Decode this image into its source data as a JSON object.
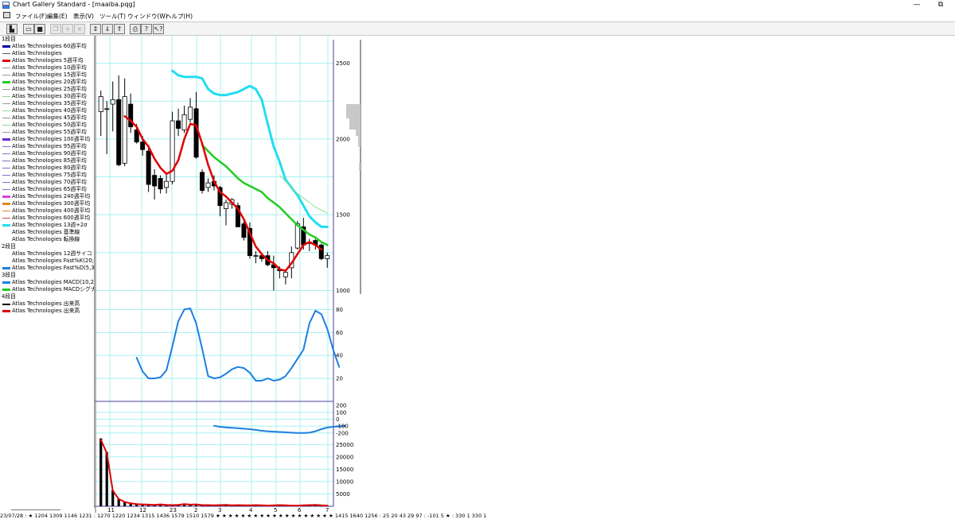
{
  "window": {
    "title": "Chart Gallery Standard - [maaiba.pqg]",
    "minimize_glyph": "—",
    "restore_glyph": "⧉"
  },
  "menu": [
    "ファイル(F)",
    "編集(E)",
    "表示(V)",
    "ツール(T)",
    "ウィンドウ(W)",
    "ヘルプ(H)"
  ],
  "toolbar": [
    {
      "name": "new-chart-icon",
      "glyph": "▙",
      "enabled": true
    },
    {
      "name": "open-folder-icon",
      "glyph": "▭",
      "enabled": true
    },
    {
      "name": "save-disk-icon",
      "glyph": "■",
      "enabled": true
    },
    {
      "name": "copy-icon",
      "glyph": "❐",
      "enabled": false
    },
    {
      "name": "add-icon",
      "glyph": "+",
      "enabled": false
    },
    {
      "name": "delete-icon",
      "glyph": "×",
      "enabled": false
    },
    {
      "name": "zoom-fit-icon",
      "glyph": "↕",
      "enabled": true
    },
    {
      "name": "scroll-down-icon",
      "glyph": "⇓",
      "enabled": true
    },
    {
      "name": "scroll-up-icon",
      "glyph": "⇑",
      "enabled": true
    },
    {
      "name": "print-icon",
      "glyph": "⎙",
      "enabled": true
    },
    {
      "name": "help-icon",
      "glyph": "?",
      "enabled": true
    },
    {
      "name": "context-help-icon",
      "glyph": "↖?",
      "enabled": true
    }
  ],
  "legend": [
    {
      "header": "1段目"
    },
    {
      "label": "Atlas  Technologies  60週平均",
      "color": "#0000a0",
      "weight": 3
    },
    {
      "label": "Atlas  Technologies",
      "color": "#5a5a5a",
      "weight": 1
    },
    {
      "label": "Atlas  Technologies  5週平均",
      "color": "#e00000",
      "weight": 3
    },
    {
      "label": "Atlas  Technologies  10週平均",
      "color": "#9a9a9a",
      "weight": 1
    },
    {
      "label": "Atlas  Technologies  15週平均",
      "color": "#9a9a9a",
      "weight": 1
    },
    {
      "label": "Atlas  Technologies  20週平均",
      "color": "#22cc22",
      "weight": 3
    },
    {
      "label": "Atlas  Technologies  25週平均",
      "color": "#9a9a9a",
      "weight": 1
    },
    {
      "label": "Atlas  Technologies  30週平均",
      "color": "#8fd88f",
      "weight": 1
    },
    {
      "label": "Atlas  Technologies  35週平均",
      "color": "#9a9a9a",
      "weight": 1
    },
    {
      "label": "Atlas  Technologies  40週平均",
      "color": "#8fd88f",
      "weight": 1
    },
    {
      "label": "Atlas  Technologies  45週平均",
      "color": "#9a9a9a",
      "weight": 1
    },
    {
      "label": "Atlas  Technologies  50週平均",
      "color": "#8fd88f",
      "weight": 1
    },
    {
      "label": "Atlas  Technologies  55週平均",
      "color": "#9a9a9a",
      "weight": 1
    },
    {
      "label": "Atlas  Technologies  100週平均",
      "color": "#6a2bd6",
      "weight": 3
    },
    {
      "label": "Atlas  Technologies  95週平均",
      "color": "#7878c8",
      "weight": 1
    },
    {
      "label": "Atlas  Technologies  90週平均",
      "color": "#7878c8",
      "weight": 1
    },
    {
      "label": "Atlas  Technologies  85週平均",
      "color": "#7878c8",
      "weight": 1
    },
    {
      "label": "Atlas  Technologies  80週平均",
      "color": "#7878c8",
      "weight": 1
    },
    {
      "label": "Atlas  Technologies  75週平均",
      "color": "#7878c8",
      "weight": 1
    },
    {
      "label": "Atlas  Technologies  70週平均",
      "color": "#7878c8",
      "weight": 1
    },
    {
      "label": "Atlas  Technologies  65週平均",
      "color": "#7878c8",
      "weight": 1
    },
    {
      "label": "Atlas  Technologies  240週平均",
      "color": "#e040e0",
      "weight": 3
    },
    {
      "label": "Atlas  Technologies  300週平均",
      "color": "#e08a20",
      "weight": 3
    },
    {
      "label": "Atlas  Technologies  400週平均",
      "color": "#e08a20",
      "weight": 1
    },
    {
      "label": "Atlas  Technologies  600週平均",
      "color": "#c05050",
      "weight": 1
    },
    {
      "label": "Atlas  Technologies  13週+2σ",
      "color": "#22ddf0",
      "weight": 3
    },
    {
      "label": "Atlas  Technologies  基準線",
      "color": "#ffffff",
      "weight": 1
    },
    {
      "label": "Atlas  Technologies  転換線",
      "color": "#ffffff",
      "weight": 1
    },
    {
      "header": "2段目"
    },
    {
      "label": "Atlas  Technologies  12週サイコ",
      "color": "#ffffff",
      "weight": 1
    },
    {
      "label": "Atlas  Technologies  Fast%K(20;",
      "color": "#ffffff",
      "weight": 1
    },
    {
      "label": "Atlas  Technologies  Fast%D(5,3",
      "color": "#1e7fe0",
      "weight": 3
    },
    {
      "header": "3段目"
    },
    {
      "label": "Atlas  Technologies  MACD(10,2",
      "color": "#1e7fe0",
      "weight": 3
    },
    {
      "label": "Atlas  Technologies  MACDシグナ",
      "color": "#22cc22",
      "weight": 3
    },
    {
      "header": "4段目"
    },
    {
      "label": "Atlas  Technologies  出来高",
      "color": "#000000",
      "weight": 2
    },
    {
      "label": "Atlas  Technologies  出来高",
      "color": "#e00000",
      "weight": 3
    }
  ],
  "x_axis_labels": [
    "11",
    "12",
    "23",
    "2",
    "3",
    "4",
    "5",
    "6",
    "7"
  ],
  "price_axis": {
    "ticks": [
      "2500",
      "2000",
      "1500",
      "1000"
    ],
    "values": [
      2500,
      2000,
      1500,
      1000
    ],
    "min": 950,
    "max": 2650
  },
  "osc_axis": {
    "ticks": [
      "80",
      "60",
      "40",
      "20"
    ],
    "values": [
      80,
      60,
      40,
      20
    ],
    "min": 0,
    "max": 90
  },
  "macd_axis": {
    "ticks": [
      "200",
      "100",
      "0",
      "-100",
      "-200"
    ],
    "values": [
      200,
      100,
      0,
      -100,
      -200
    ],
    "min": -260,
    "max": 260
  },
  "volume_axis": {
    "ticks": [
      "25000",
      "20000",
      "15000",
      "10000",
      "5000"
    ],
    "values": [
      25000,
      20000,
      15000,
      10000,
      5000
    ],
    "min": 0,
    "max": 28000
  },
  "colors": {
    "grid": "#a8f0f0",
    "candle_down": "#000000",
    "ma5": "#e00000",
    "ma20": "#22cc22",
    "ma30": "#90e090",
    "band": "#22ddf0",
    "oscillator": "#1e7fe0",
    "macd": "#1e7fe0",
    "volume_line": "#e00000",
    "axis": "#4b3c9c"
  },
  "candles": [
    {
      "o": 2180,
      "h": 2320,
      "l": 2020,
      "c": 2280
    },
    {
      "o": 2200,
      "h": 2250,
      "l": 1900,
      "c": 2200
    },
    {
      "o": 2230,
      "h": 2380,
      "l": 2050,
      "c": 2260
    },
    {
      "o": 2260,
      "h": 2420,
      "l": 1820,
      "c": 1830
    },
    {
      "o": 1840,
      "h": 2400,
      "l": 1820,
      "c": 2280
    },
    {
      "o": 2230,
      "h": 2300,
      "l": 2040,
      "c": 2080
    },
    {
      "o": 2060,
      "h": 2100,
      "l": 1970,
      "c": 1980
    },
    {
      "o": 1980,
      "h": 2020,
      "l": 1890,
      "c": 1930
    },
    {
      "o": 1920,
      "h": 1960,
      "l": 1650,
      "c": 1700
    },
    {
      "o": 1760,
      "h": 1800,
      "l": 1600,
      "c": 1690
    },
    {
      "o": 1740,
      "h": 1760,
      "l": 1640,
      "c": 1670
    },
    {
      "o": 1680,
      "h": 1780,
      "l": 1640,
      "c": 1720
    },
    {
      "o": 1720,
      "h": 2180,
      "l": 1700,
      "c": 2120
    },
    {
      "o": 2120,
      "h": 2200,
      "l": 2020,
      "c": 2070
    },
    {
      "o": 2060,
      "h": 2220,
      "l": 2040,
      "c": 2160
    },
    {
      "o": 2130,
      "h": 2270,
      "l": 2110,
      "c": 2210
    },
    {
      "o": 2200,
      "h": 2310,
      "l": 1870,
      "c": 1880
    },
    {
      "o": 1780,
      "h": 1800,
      "l": 1640,
      "c": 1660
    },
    {
      "o": 1680,
      "h": 1740,
      "l": 1650,
      "c": 1710
    },
    {
      "o": 1720,
      "h": 1760,
      "l": 1660,
      "c": 1690
    },
    {
      "o": 1680,
      "h": 1690,
      "l": 1490,
      "c": 1560
    },
    {
      "o": 1540,
      "h": 1600,
      "l": 1430,
      "c": 1580
    },
    {
      "o": 1570,
      "h": 1610,
      "l": 1540,
      "c": 1600
    },
    {
      "o": 1560,
      "h": 1580,
      "l": 1420,
      "c": 1420
    },
    {
      "o": 1440,
      "h": 1470,
      "l": 1330,
      "c": 1350
    },
    {
      "o": 1410,
      "h": 1450,
      "l": 1210,
      "c": 1230
    },
    {
      "o": 1230,
      "h": 1260,
      "l": 1180,
      "c": 1230
    },
    {
      "o": 1230,
      "h": 1250,
      "l": 1190,
      "c": 1210
    },
    {
      "o": 1230,
      "h": 1260,
      "l": 1160,
      "c": 1170
    },
    {
      "o": 1170,
      "h": 1230,
      "l": 1000,
      "c": 1150
    },
    {
      "o": 1140,
      "h": 1160,
      "l": 1080,
      "c": 1130
    },
    {
      "o": 1090,
      "h": 1140,
      "l": 1040,
      "c": 1120
    },
    {
      "o": 1150,
      "h": 1290,
      "l": 1080,
      "c": 1250
    },
    {
      "o": 1280,
      "h": 1460,
      "l": 1270,
      "c": 1440
    },
    {
      "o": 1420,
      "h": 1480,
      "l": 1270,
      "c": 1300
    },
    {
      "o": 1310,
      "h": 1340,
      "l": 1260,
      "c": 1320
    },
    {
      "o": 1330,
      "h": 1340,
      "l": 1270,
      "c": 1300
    },
    {
      "o": 1300,
      "h": 1310,
      "l": 1200,
      "c": 1210
    },
    {
      "o": 1210,
      "h": 1250,
      "l": 1150,
      "c": 1230
    }
  ],
  "ma5": [
    2150,
    2120,
    2080,
    2000,
    1950,
    1870,
    1810,
    1770,
    1790,
    1860,
    2000,
    2100,
    2090,
    1970,
    1830,
    1720,
    1650,
    1620,
    1580,
    1540,
    1470,
    1380,
    1290,
    1240,
    1200,
    1180,
    1140,
    1130,
    1180,
    1240,
    1300,
    1320,
    1300,
    1270
  ],
  "ma5_start": 4,
  "ma20": [
    1960,
    1920,
    1880,
    1850,
    1820,
    1780,
    1740,
    1710,
    1690,
    1670,
    1650,
    1610,
    1580,
    1550,
    1510,
    1470,
    1430,
    1400,
    1370,
    1350,
    1320,
    1300
  ],
  "ma20_start": 17,
  "ma30": [
    1760,
    1720,
    1680,
    1640,
    1610,
    1580,
    1550,
    1530,
    1510
  ],
  "ma30_start": 30,
  "band_upper": [
    2450,
    2420,
    2410,
    2410,
    2410,
    2400,
    2330,
    2300,
    2290,
    2290,
    2300,
    2310,
    2330,
    2350,
    2330,
    2260,
    2100,
    1950,
    1850,
    1730,
    1680,
    1630,
    1560,
    1490,
    1450,
    1420,
    1420
  ],
  "band_start": 12,
  "oscillator": [
    38,
    26,
    20,
    20,
    21,
    27,
    48,
    70,
    80,
    81,
    68,
    46,
    22,
    20,
    21,
    24,
    28,
    30,
    29,
    25,
    18,
    18,
    20,
    18,
    19,
    22,
    29,
    37,
    45,
    68,
    79,
    76,
    63,
    45,
    30
  ],
  "oscillator_start": 6,
  "macd": [
    -95,
    -110,
    -118,
    -125,
    -130,
    -138,
    -145,
    -155,
    -168,
    -175,
    -180,
    -185,
    -190,
    -195,
    -200,
    -200,
    -195,
    -175,
    -145,
    -120,
    -110,
    -100,
    -98
  ],
  "macd_start": 19,
  "volume": [
    27500,
    22000,
    6500,
    3000,
    1800,
    1200,
    900,
    800,
    700,
    600,
    800,
    600,
    500,
    600,
    900,
    700,
    800,
    500,
    500,
    400,
    500,
    600,
    400,
    500,
    400,
    400,
    500,
    400,
    300,
    400,
    500,
    400,
    300,
    300,
    400,
    500,
    600,
    400,
    300
  ],
  "status_line": "23/07/28 : ★ 1204 1309 1146 1231 : 1270 1220 1234 1315 1436 1579 1510 1579 ★ ★ ★ ★ ★ ★ ★ ★ ★ ★ ★ ★ ★ ★ ★ ★ ★ ★ ★ 1415 1640 1256 : 25 20 43 29 97 : -101 5 ★ : 330 1 330 1"
}
